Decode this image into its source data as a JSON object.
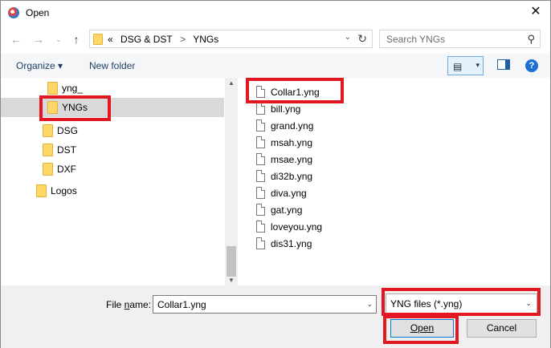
{
  "window": {
    "title": "Open"
  },
  "address_bar": {
    "prefix": "«",
    "crumbs": [
      "DSG & DST",
      "YNGs"
    ],
    "separator": ">"
  },
  "search": {
    "placeholder": "Search YNGs"
  },
  "toolbar": {
    "organize_label": "Organize ▾",
    "new_folder_label": "New folder",
    "help_label": "?"
  },
  "nav": {
    "items": [
      {
        "label": "yng_",
        "icon": "folder-icon",
        "selected": false
      },
      {
        "label": "YNGs",
        "icon": "folder-icon",
        "selected": true
      },
      {
        "label": "DSG",
        "icon": "folder-icon",
        "selected": false
      },
      {
        "label": "DST",
        "icon": "folder-icon",
        "selected": false
      },
      {
        "label": "DXF",
        "icon": "folder-icon",
        "selected": false
      },
      {
        "label": "Logos",
        "icon": "folder-icon",
        "selected": false
      }
    ]
  },
  "files": [
    {
      "name": "Collar1.yng",
      "selected": true
    },
    {
      "name": "bill.yng",
      "selected": false
    },
    {
      "name": "grand.yng",
      "selected": false
    },
    {
      "name": "msah.yng",
      "selected": false
    },
    {
      "name": "msae.yng",
      "selected": false
    },
    {
      "name": "di32b.yng",
      "selected": false
    },
    {
      "name": "diva.yng",
      "selected": false
    },
    {
      "name": "gat.yng",
      "selected": false
    },
    {
      "name": "loveyou.yng",
      "selected": false
    },
    {
      "name": "dis31.yng",
      "selected": false
    }
  ],
  "bottom": {
    "file_name_label_prefix": "File ",
    "file_name_label_underlined": "n",
    "file_name_label_suffix": "ame:",
    "file_name_value": "Collar1.yng",
    "file_type_value": "YNG files (*.yng)",
    "open_label": "Open",
    "cancel_label": "Cancel"
  },
  "colors": {
    "highlight": "#e11722",
    "selection": "#d9d9d9",
    "accent": "#0078d7"
  }
}
